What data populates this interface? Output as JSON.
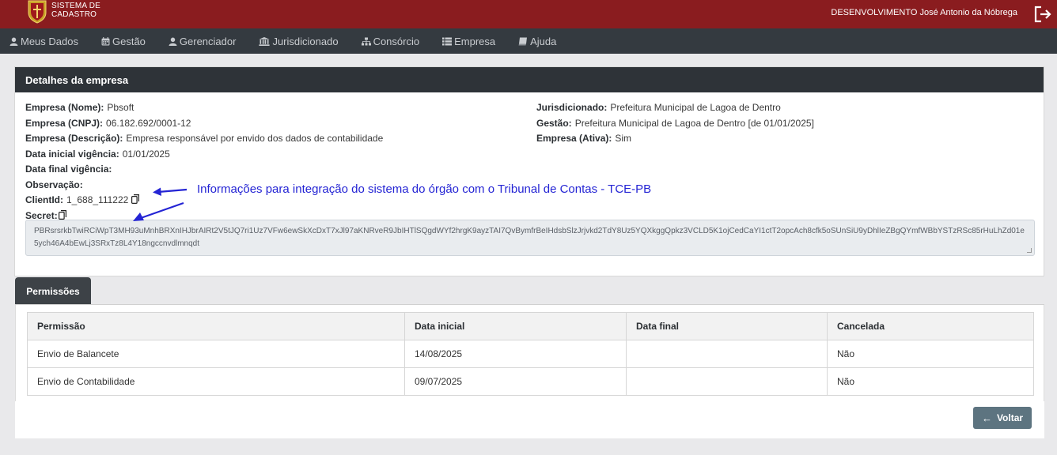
{
  "header": {
    "system_line1": "SISTEMA DE",
    "system_line2": "CADASTRO",
    "user": "DESENVOLVIMENTO José Antonio da Nóbrega"
  },
  "nav": {
    "items": [
      {
        "label": "Meus Dados",
        "icon": "user-icon"
      },
      {
        "label": "Gestão",
        "icon": "calendar-icon"
      },
      {
        "label": "Gerenciador",
        "icon": "user-icon"
      },
      {
        "label": "Jurisdicionado",
        "icon": "institution-icon"
      },
      {
        "label": "Consórcio",
        "icon": "sitemap-icon"
      },
      {
        "label": "Empresa",
        "icon": "list-icon"
      },
      {
        "label": "Ajuda",
        "icon": "book-icon"
      }
    ]
  },
  "card": {
    "title": "Detalhes da empresa",
    "left": [
      {
        "label": "Empresa (Nome):",
        "value": "Pbsoft"
      },
      {
        "label": "Empresa (CNPJ):",
        "value": "06.182.692/0001-12"
      },
      {
        "label": "Empresa (Descrição):",
        "value": "Empresa responsável por envido dos dados de contabilidade"
      },
      {
        "label": "Data inicial vigência:",
        "value": "01/01/2025"
      },
      {
        "label": "Data final vigência:",
        "value": ""
      },
      {
        "label": "Observação:",
        "value": ""
      },
      {
        "label": "ClientId:",
        "value": "1_688_111222"
      },
      {
        "label": "Secret:",
        "value": ""
      }
    ],
    "right": [
      {
        "label": "Jurisdicionado:",
        "value": "Prefeitura Municipal de Lagoa de Dentro"
      },
      {
        "label": "Gestão:",
        "value": "Prefeitura Municipal de Lagoa de Dentro [de 01/01/2025]"
      },
      {
        "label": "Empresa (Ativa):",
        "value": "Sim"
      }
    ],
    "secret": "PBRsrsrkbTwiRCiWpT3MH93uMnhBRXnIHJbrAIRt2V5tJQ7ri1Uz7VFw6ewSkXcDxT7xJl97aKNRveR9JbIHTlSQgdWYf2hrgK9ayzTAI7QvBymfrBeIHdsbSlzJrjvkd2TdY8Uz5YQXkggQpkz3VCLD5K1ojCedCaYI1ctT2opcAch8cfk5oSUnSiU9yDhlIeZBgQYmfWBbYSTzRSc85rHuLhZd01e5ych46A4bEwLj3SRxTz8L4Y18ngccnvdlmnqdt"
  },
  "annotation": "Informações para integração do sistema do órgão com o Tribunal de Contas - TCE-PB",
  "permissions": {
    "tab_label": "Permissões",
    "columns": [
      "Permissão",
      "Data inicial",
      "Data final",
      "Cancelada"
    ],
    "rows": [
      [
        "Envio de Balancete",
        "14/08/2025",
        "",
        "Não"
      ],
      [
        "Envio de Contabilidade",
        "09/07/2025",
        "",
        "Não"
      ]
    ]
  },
  "footer": {
    "back_label": "Voltar"
  },
  "colors": {
    "topbar": "#8a1c1f",
    "navbar": "#343a40",
    "card_header": "#2e3338",
    "annotation": "#2424d4",
    "back_button": "#5d7480"
  }
}
